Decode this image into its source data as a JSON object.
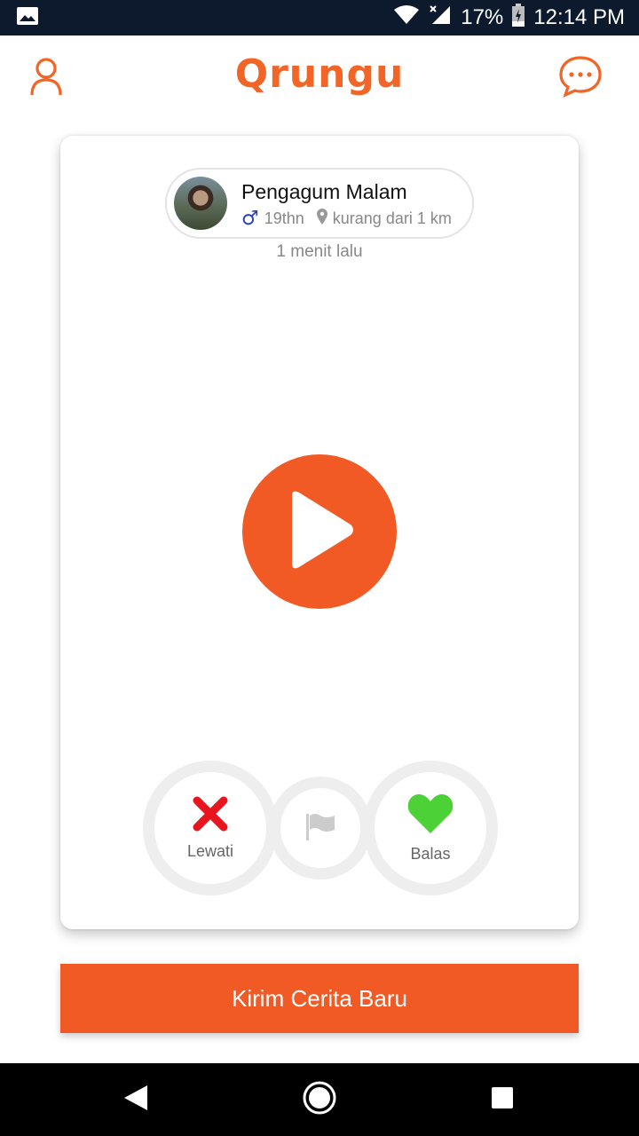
{
  "status_bar": {
    "battery": "17%",
    "time": "12:14 PM"
  },
  "header": {
    "app_name": "Qrungu",
    "icons": {
      "left": "profile-icon",
      "right": "chat-icon"
    }
  },
  "story": {
    "author_name": "Pengagum Malam",
    "age": "19thn",
    "distance": "kurang dari 1 km",
    "posted": "1 menit lalu"
  },
  "actions": {
    "skip_label": "Lewati",
    "reply_label": "Balas"
  },
  "new_story_label": "Kirim Cerita Baru",
  "colors": {
    "accent": "#f15a24",
    "skip": "#e8141e",
    "reply": "#4cd137",
    "male": "#2a3fbf"
  }
}
